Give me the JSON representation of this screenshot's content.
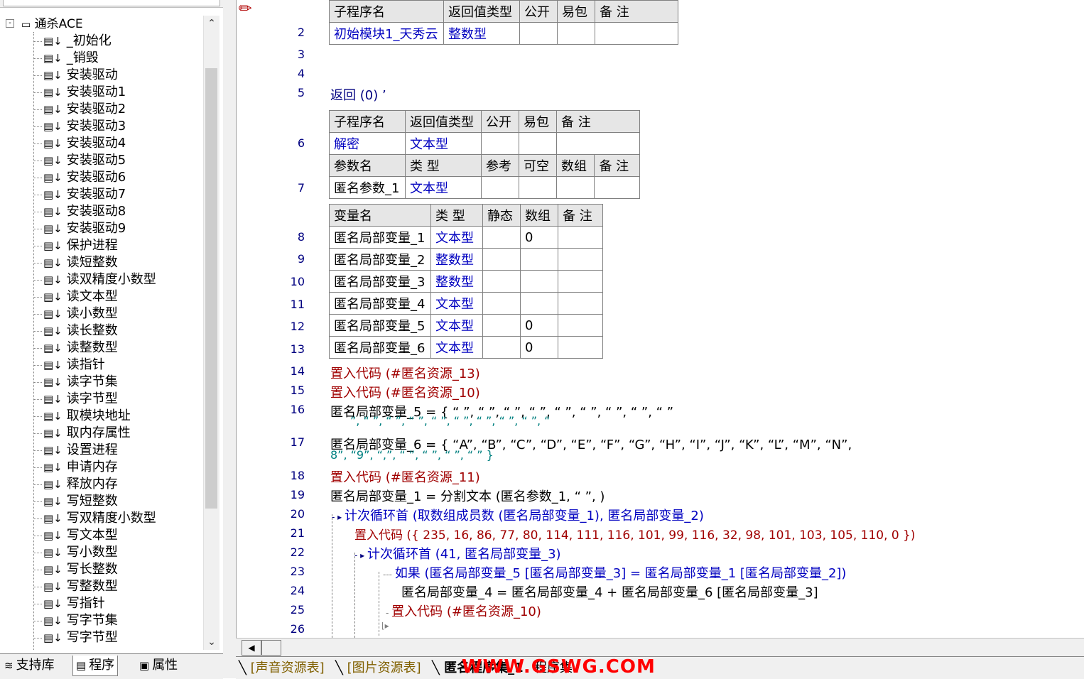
{
  "tree": {
    "root_label": "通杀ACE",
    "root_expander": "-",
    "items": [
      "_初始化",
      "_销毁",
      "安装驱动",
      "安装驱动1",
      "安装驱动2",
      "安装驱动3",
      "安装驱动4",
      "安装驱动5",
      "安装驱动6",
      "安装驱动7",
      "安装驱动8",
      "安装驱动9",
      "保护进程",
      "读短整数",
      "读双精度小数型",
      "读文本型",
      "读小数型",
      "读长整数",
      "读整数型",
      "读指针",
      "读字节集",
      "读字节型",
      "取模块地址",
      "取内存属性",
      "设置进程",
      "申请内存",
      "释放内存",
      "写短整数",
      "写双精度小数型",
      "写文本型",
      "写小数型",
      "写长整数",
      "写整数型",
      "写指针",
      "写字节集",
      "写字节型"
    ]
  },
  "left_tabs": [
    "支持库",
    "程序",
    "属性"
  ],
  "code": {
    "table1": {
      "headers": [
        "子程序名",
        "返回值类型",
        "公开",
        "易包",
        "备 注"
      ],
      "row": [
        "初始模块1_天秀云",
        "整数型",
        "",
        "",
        ""
      ]
    },
    "line5": "返回 (0) ’",
    "table2": {
      "headers": [
        "子程序名",
        "返回值类型",
        "公开",
        "易包",
        "备 注"
      ],
      "row": [
        "解密",
        "文本型",
        "",
        "",
        ""
      ],
      "param_headers": [
        "参数名",
        "类 型",
        "参考",
        "可空",
        "数组",
        "备 注"
      ],
      "param_row": [
        "匿名参数_1",
        "文本型",
        "",
        "",
        "",
        ""
      ]
    },
    "table3": {
      "headers": [
        "变量名",
        "类 型",
        "静态",
        "数组",
        "备 注"
      ],
      "rows": [
        [
          "匿名局部变量_1",
          "文本型",
          "",
          "0",
          ""
        ],
        [
          "匿名局部变量_2",
          "整数型",
          "",
          "",
          ""
        ],
        [
          "匿名局部变量_3",
          "整数型",
          "",
          "",
          ""
        ],
        [
          "匿名局部变量_4",
          "文本型",
          "",
          "",
          ""
        ],
        [
          "匿名局部变量_5",
          "文本型",
          "",
          "0",
          ""
        ],
        [
          "匿名局部变量_6",
          "文本型",
          "",
          "0",
          ""
        ]
      ]
    },
    "line_numbers": [
      "2",
      "3",
      "4",
      "5",
      "6",
      "7",
      "8",
      "9",
      "10",
      "11",
      "12",
      "13",
      "14",
      "15",
      "16",
      "17",
      "18",
      "19",
      "20",
      "21",
      "22",
      "23",
      "24",
      "25",
      "26"
    ],
    "l14": "置入代码 (#匿名资源_13)",
    "l15": "置入代码 (#匿名资源_10)",
    "l16a": "匿名局部变量_5 = { “   ”, “        ”, “      ”, “      ”, “ ”, “      ”, “  ”, “         ”, “    ”",
    "l16b": "”, “       ”, “    ”, “      ”, “     ”, “      ”, “    ”, “    ”, “      ”, “",
    "l17a": "匿名局部变量_6 = { “A”, “B”, “C”, “D”, “E”, “F”, “G”, “H”, “I”, “J”, “K”, “L”, “M”, “N”,",
    "l17b": "8”, “9”, “,”, “ ”, “ ”, “ ”, “ ” }",
    "l18": "置入代码 (#匿名资源_11)",
    "l19": "匿名局部变量_1 = 分割文本 (匿名参数_1, “  ”, )",
    "l20": "计次循环首 (取数组成员数 (匿名局部变量_1), 匿名局部变量_2)",
    "l21": "置入代码 ({ 235, 16, 86, 77, 80, 114, 111, 116, 101, 99, 116, 32, 98, 101, 103, 105, 110, 0 })",
    "l22": "计次循环首 (41, 匿名局部变量_3)",
    "l23": "如果 (匿名局部变量_5 [匿名局部变量_3] = 匿名局部变量_1 [匿名局部变量_2])",
    "l24": "匿名局部变量_4 = 匿名局部变量_4 + 匿名局部变量_6 [匿名局部变量_3]",
    "l25": "置入代码 (#匿名资源_10)"
  },
  "bottom_tabs": [
    "[声音资源表]",
    "[图片资源表]",
    "匿名程序集_1",
    "程序集"
  ],
  "watermark": "WWW.GSWG.COM"
}
